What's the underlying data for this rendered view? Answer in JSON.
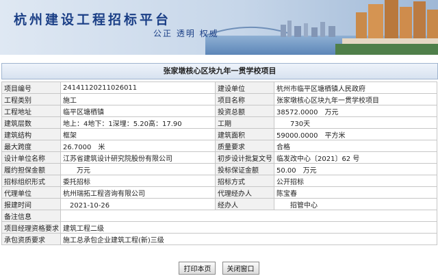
{
  "header": {
    "site_title": "杭州建设工程招标平台",
    "slogan": "公正 透明 权威"
  },
  "project_title": "张家墩核心区块九年一贯学校项目",
  "rows": [
    {
      "l1": "项目编号",
      "v1": "24141120211026011",
      "l2": "建设单位",
      "v2": "杭州市临平区塘栖镇人民政府"
    },
    {
      "l1": "工程类别",
      "v1": "施工",
      "l2": "项目名称",
      "v2": "张家墩核心区块九年一贯学校项目"
    },
    {
      "l1": "工程地址",
      "v1": "临平区塘栖镇",
      "l2": "投资总额",
      "v2": "38572.0000　万元"
    },
    {
      "l1": "建筑层数",
      "v1": "地上：4地下：1深埋：5.20高：17.90",
      "l2": "工期",
      "v2": "　　730天"
    },
    {
      "l1": "建筑结构",
      "v1": "框架",
      "l2": "建筑面积",
      "v2": "59000.0000　平方米"
    },
    {
      "l1": "最大跨度",
      "v1": "26.7000　米",
      "l2": "质量要求",
      "v2": "合格"
    },
    {
      "l1": "设计单位名称",
      "v1": "江苏省建筑设计研究院股份有限公司",
      "l2": "初步设计批复文号",
      "v2": "临发改中心〔2021〕62 号"
    },
    {
      "l1": "履约担保金额",
      "v1": "　　万元",
      "l2": "投标保证金额",
      "v2": "50.00　万元"
    },
    {
      "l1": "招标组织形式",
      "v1": "委托招标",
      "l2": "招标方式",
      "v2": "公开招标"
    },
    {
      "l1": "代理单位",
      "v1": "杭州瑞拓工程咨询有限公司",
      "l2": "代理经办人",
      "v2": "陈宝春"
    },
    {
      "l1": "报建时间",
      "v1": "　2021-10-26",
      "l2": "经办人",
      "v2": "　　招管中心"
    }
  ],
  "wide_rows": [
    {
      "label": "备注信息",
      "value": ""
    },
    {
      "label": "项目经理资格要求",
      "value": "建筑工程二级"
    },
    {
      "label": "承包资质要求",
      "value": "施工总承包企业建筑工程(新)三级"
    }
  ],
  "buttons": {
    "print": "打印本页",
    "close": "关闭窗口"
  }
}
